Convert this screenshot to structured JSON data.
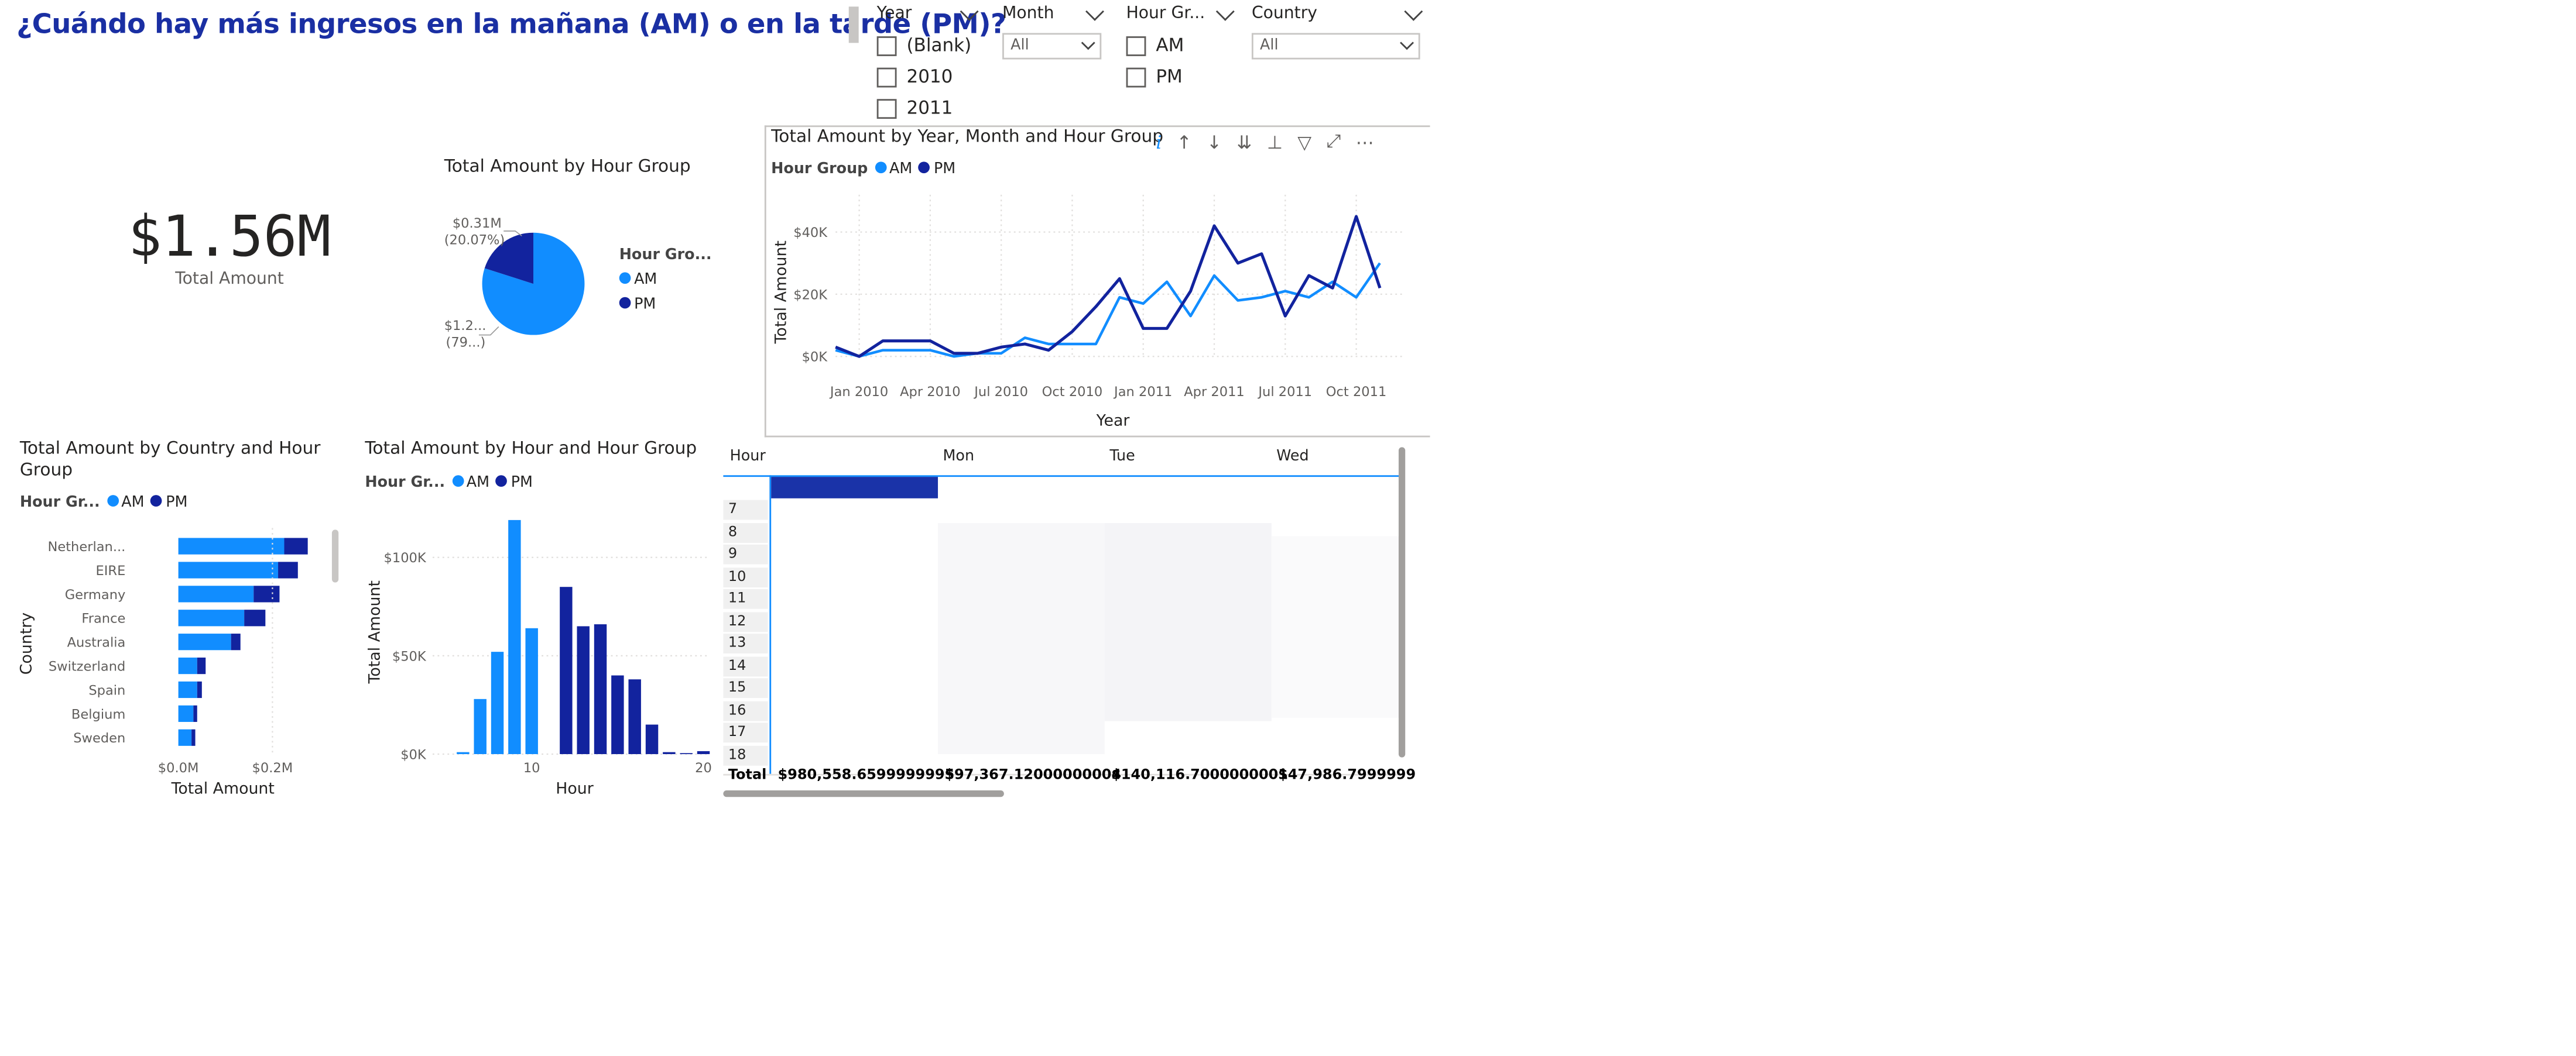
{
  "page": {
    "title": "¿Cuándo hay más ingresos en la mañana (AM) o en la tarde (PM)?"
  },
  "colors": {
    "am": "#118dff",
    "pm": "#12239e",
    "grid": "#e1dfdd",
    "selected_bar": "#1a33a8"
  },
  "slicers": {
    "year": {
      "label": "Year",
      "options": [
        "(Blank)",
        "2010",
        "2011"
      ]
    },
    "month": {
      "label": "Month",
      "value": "All"
    },
    "hour_group": {
      "label": "Hour Gr...",
      "options": [
        "AM",
        "PM"
      ]
    },
    "country": {
      "label": "Country",
      "value": "All"
    }
  },
  "kpi": {
    "value": "$1.56M",
    "label": "Total Amount"
  },
  "pie": {
    "title": "Total Amount by Hour Group",
    "label_pm_value": "$0.31M",
    "label_pm_pct": "(20.07%)",
    "label_am_value": "$1.2...",
    "label_am_pct": "(79...)",
    "legend_title": "Hour Gro...",
    "legend": [
      "AM",
      "PM"
    ]
  },
  "line_visual": {
    "title": "Total Amount by Year, Month and Hour Group",
    "legend_title": "Hour Group",
    "legend": [
      "AM",
      "PM"
    ],
    "toolbar_icons": [
      "info-icon",
      "drill-up-icon",
      "drill-down-icon",
      "expand-all-down-icon",
      "expand-hierarchy-icon",
      "filter-icon",
      "focus-mode-icon",
      "more-options-icon"
    ]
  },
  "country_visual": {
    "title_line1": "Total Amount by Country and Hour",
    "title_line2": "Group",
    "legend_title": "Hour Gr...",
    "legend": [
      "AM",
      "PM"
    ]
  },
  "hour_visual": {
    "title": "Total Amount by Hour and Hour Group",
    "legend_title": "Hour Gr...",
    "legend": [
      "AM",
      "PM"
    ]
  },
  "matrix": {
    "columns": [
      "Hour",
      "Mon",
      "Tue",
      "Wed"
    ],
    "rows": [
      "7",
      "8",
      "9",
      "10",
      "11",
      "12",
      "13",
      "14",
      "15",
      "16",
      "17",
      "18"
    ],
    "total_label": "Total",
    "totals": [
      "$980,558.6599999995",
      "$97,367.12000000004",
      "$140,116.7000000001",
      "$47,986.7999999"
    ]
  },
  "chart_data": [
    {
      "type": "line",
      "title": "Total Amount by Year, Month and Hour Group",
      "xlabel": "Year",
      "ylabel": "Total Amount",
      "x": [
        "Dec 2009",
        "Jan 2010",
        "Feb 2010",
        "Mar 2010",
        "Apr 2010",
        "May 2010",
        "Jun 2010",
        "Jul 2010",
        "Aug 2010",
        "Sep 2010",
        "Oct 2010",
        "Nov 2010",
        "Dec 2010",
        "Jan 2011",
        "Feb 2011",
        "Mar 2011",
        "Apr 2011",
        "May 2011",
        "Jun 2011",
        "Jul 2011",
        "Aug 2011",
        "Sep 2011",
        "Oct 2011",
        "Nov 2011",
        "Dec 2011"
      ],
      "x_ticks": [
        "Jan 2010",
        "Apr 2010",
        "Jul 2010",
        "Oct 2010",
        "Jan 2011",
        "Apr 2011",
        "Jul 2011",
        "Oct 2011"
      ],
      "y_ticks": [
        "$0K",
        "$20K",
        "$40K"
      ],
      "ylim": [
        0,
        52000
      ],
      "series": [
        {
          "name": "AM",
          "values": [
            2000,
            0,
            2000,
            2000,
            2000,
            0,
            1000,
            1000,
            6000,
            4000,
            4000,
            4000,
            19000,
            17000,
            24000,
            13000,
            26000,
            18000,
            19000,
            21000,
            19000,
            24000,
            19000,
            30000
          ]
        },
        {
          "name": "PM",
          "values": [
            3000,
            0,
            5000,
            5000,
            5000,
            1000,
            1000,
            3000,
            4000,
            2000,
            8000,
            16000,
            25000,
            9000,
            9000,
            21000,
            42000,
            30000,
            33000,
            13000,
            26000,
            22000,
            45000,
            22000
          ]
        }
      ]
    },
    {
      "type": "bar",
      "title": "Total Amount by Country and Hour Group",
      "orientation": "horizontal",
      "stacked": true,
      "xlabel": "Total Amount",
      "ylabel": "Country",
      "categories": [
        "Netherlan...",
        "EIRE",
        "Germany",
        "France",
        "Australia",
        "Switzerland",
        "Spain",
        "Belgium",
        "Sweden"
      ],
      "x_ticks": [
        "$0.0M",
        "$0.2M"
      ],
      "xlim": [
        0,
        0.3
      ],
      "series": [
        {
          "name": "AM",
          "values": [
            0.225,
            0.212,
            0.16,
            0.14,
            0.112,
            0.04,
            0.04,
            0.032,
            0.028
          ]
        },
        {
          "name": "PM",
          "values": [
            0.05,
            0.042,
            0.055,
            0.045,
            0.02,
            0.018,
            0.01,
            0.008,
            0.008
          ]
        }
      ]
    },
    {
      "type": "bar",
      "title": "Total Amount by Hour and Hour Group",
      "xlabel": "Hour",
      "ylabel": "Total Amount",
      "x_ticks": [
        "10",
        "20"
      ],
      "y_ticks": [
        "$0K",
        "$50K",
        "$100K"
      ],
      "ylim": [
        0,
        125000
      ],
      "series": [
        {
          "name": "AM",
          "x": [
            6,
            7,
            8,
            9,
            10,
            11
          ],
          "values": [
            1000,
            28000,
            52000,
            119000,
            64000,
            0
          ]
        },
        {
          "name": "PM",
          "x": [
            12,
            13,
            14,
            15,
            16,
            17,
            18,
            19,
            20
          ],
          "values": [
            85000,
            65000,
            66000,
            40000,
            38000,
            15000,
            1000,
            500,
            1500
          ]
        }
      ]
    },
    {
      "type": "pie",
      "title": "Total Amount by Hour Group",
      "categories": [
        "AM",
        "PM"
      ],
      "values": [
        79.93,
        20.07
      ]
    }
  ]
}
